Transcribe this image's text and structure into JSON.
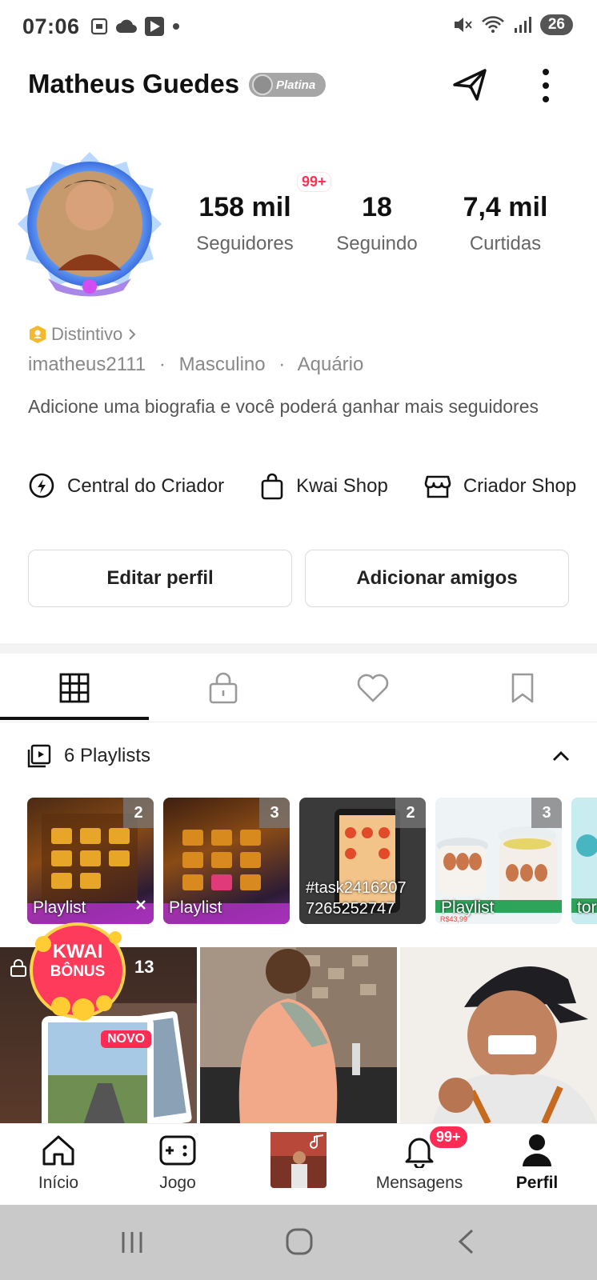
{
  "status_bar": {
    "time": "07:06",
    "battery": "26"
  },
  "header": {
    "name": "Matheus Guedes",
    "tier": "Platina"
  },
  "stats": {
    "followers": {
      "value": "158 mil",
      "label": "Seguidores",
      "badge": "99+"
    },
    "following": {
      "value": "18",
      "label": "Seguindo"
    },
    "likes": {
      "value": "7,4 mil",
      "label": "Curtidas"
    }
  },
  "profile": {
    "distintivo": "Distintivo",
    "username": "imatheus2111",
    "gender": "Masculino",
    "sign": "Aquário",
    "separator": "·",
    "bio": "Adicione uma biografia e você poderá ganhar mais seguidores"
  },
  "links": [
    {
      "label": "Central do Criador",
      "icon": "lightning-circle-icon"
    },
    {
      "label": "Kwai Shop",
      "icon": "shopping-bag-icon"
    },
    {
      "label": "Criador Shop",
      "icon": "store-icon"
    }
  ],
  "buttons": {
    "edit": "Editar perfil",
    "add_friends": "Adicionar amigos"
  },
  "tabs": [
    {
      "name": "grid",
      "icon": "grid-icon"
    },
    {
      "name": "private",
      "icon": "lock-icon"
    },
    {
      "name": "liked",
      "icon": "heart-icon"
    },
    {
      "name": "saved",
      "icon": "bookmark-icon"
    }
  ],
  "playlists": {
    "header": "6 Playlists",
    "items": [
      {
        "count": "2",
        "label": "Playlist",
        "caption": ""
      },
      {
        "count": "3",
        "label": "Playlist",
        "caption": ""
      },
      {
        "count": "2",
        "label": "",
        "caption": "#task2416207 7265252747"
      },
      {
        "count": "3",
        "label": "Playlist",
        "caption": ""
      },
      {
        "count": "",
        "label": "tor",
        "caption": ""
      }
    ]
  },
  "videos": {
    "bonus_line1": "KWAI",
    "bonus_line2": "BÔNUS",
    "locked_count": "13",
    "new_badge": "NOVO"
  },
  "bottom_nav": {
    "home": "Início",
    "game": "Jogo",
    "messages": "Mensagens",
    "messages_badge": "99+",
    "profile": "Perfil"
  }
}
